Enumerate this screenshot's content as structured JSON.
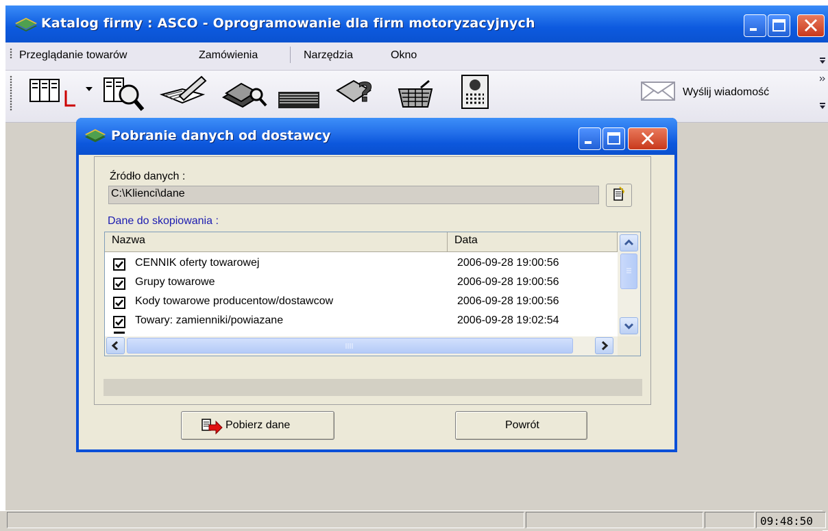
{
  "window": {
    "title": "Katalog firmy : ASCO - Oprogramowanie dla firm motoryzacyjnych"
  },
  "menu": {
    "items": [
      "Przeglądanie towarów",
      "Zamówienia",
      "Narzędzia",
      "Okno"
    ]
  },
  "toolbar": {
    "icons": [
      "catalog-browse-icon",
      "catalog-search-icon",
      "edit-notes-icon",
      "books-search-icon",
      "documents-icon",
      "help-books-icon",
      "shopping-basket-icon",
      "phone-icon",
      "envelope-icon"
    ],
    "send_message_label": "Wyślij wiadomość"
  },
  "dialog": {
    "title": "Pobranie danych od dostawcy",
    "source_label": "Źródło danych :",
    "source_value": "C:\\Klienci\\dane",
    "copy_label": "Dane do skopiowania :",
    "columns": [
      "Nazwa",
      "Data"
    ],
    "rows": [
      {
        "name": "CENNIK oferty towarowej",
        "date": "2006-09-28 19:00:56",
        "checked": true
      },
      {
        "name": "Grupy towarowe",
        "date": "2006-09-28 19:00:56",
        "checked": true
      },
      {
        "name": "Kody towarowe producentow/dostawcow",
        "date": "2006-09-28 19:00:56",
        "checked": true
      },
      {
        "name": "Towary: zamienniki/powiazane",
        "date": "2006-09-28 19:02:54",
        "checked": true
      }
    ],
    "fetch_button": "Pobierz dane",
    "back_button": "Powrót"
  },
  "status": {
    "time": "09:48:50"
  },
  "colors": {
    "title_blue": "#0a52d0",
    "close_red": "#c8391c",
    "dialog_face": "#ece9d8",
    "label_blue": "#1b1bb0"
  }
}
